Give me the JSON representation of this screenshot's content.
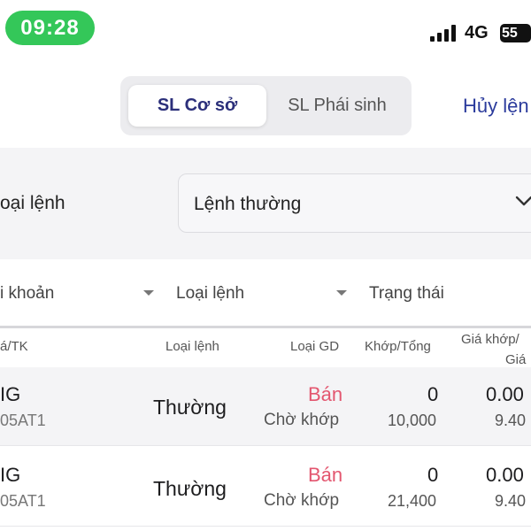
{
  "status_bar": {
    "time": "09:28",
    "network": "4G",
    "battery": "55"
  },
  "segments": {
    "base": "SL Cơ sở",
    "derivative": "SL Phái sinh"
  },
  "cancel_label": "Hủy lện",
  "filter": {
    "order_type_label": "oại lệnh",
    "order_type_value": "Lệnh thường"
  },
  "column_filters": {
    "account": "i khoản",
    "order_type": "Loại lệnh",
    "status": "Trạng thái"
  },
  "table": {
    "headers": {
      "symbol": "á/TK",
      "order_type": "Loại lệnh",
      "trade_type": "Loại GD",
      "matched_total": "Khớp/Tổng",
      "match_price": "Giá khớp/",
      "price": "Giá"
    },
    "rows": [
      {
        "symbol": "IG",
        "account": "05AT1",
        "order_type": "Thường",
        "side": "Bán",
        "status": "Chờ khớp",
        "matched": "0",
        "total": "10,000",
        "match_price": "0.00",
        "price": "9.40"
      },
      {
        "symbol": "IG",
        "account": "05AT1",
        "order_type": "Thường",
        "side": "Bán",
        "status": "Chờ khớp",
        "matched": "0",
        "total": "21,400",
        "match_price": "0.00",
        "price": "9.40"
      }
    ]
  },
  "colors": {
    "time_pill": "#34c759",
    "accent": "#2b3b9c",
    "sell": "#e3566f"
  }
}
